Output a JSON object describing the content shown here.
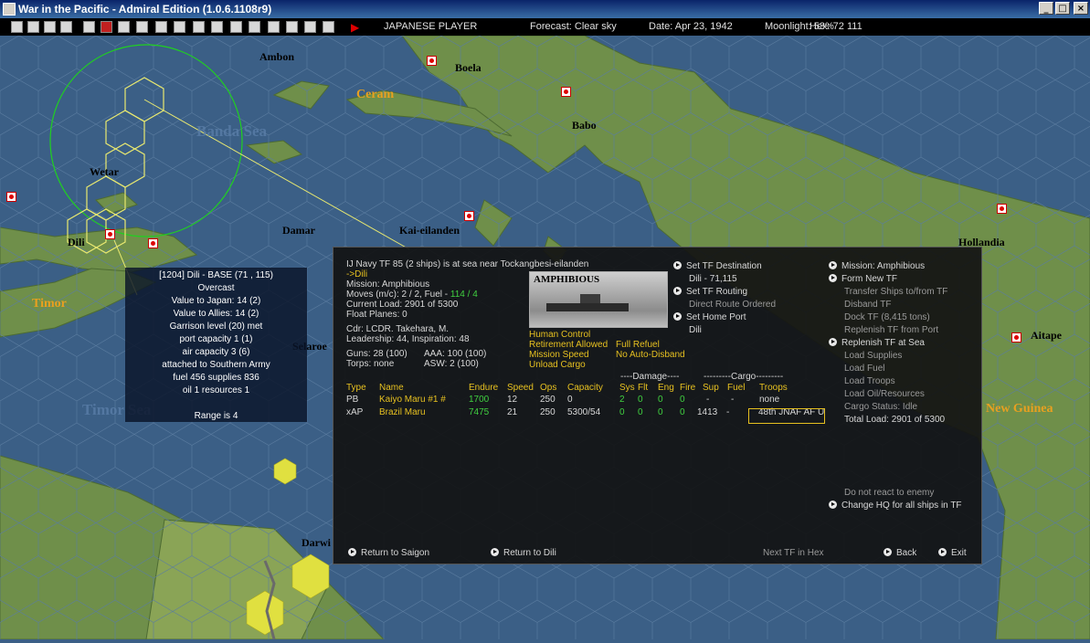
{
  "window": {
    "title": "War in the Pacific - Admiral Edition (1.0.6.1108r9)"
  },
  "status": {
    "player": "JAPANESE PLAYER",
    "forecast": "Forecast: Clear sky",
    "date": "Date: Apr 23, 1942",
    "moonlight": "Moonlight: 53%",
    "hex": "Hex: 72  111"
  },
  "toolbar": {
    "icons": [
      "save-icon",
      "document-icon",
      "report-icon",
      "info-icon",
      "japan-flag-icon",
      "ship-icon",
      "flag-icon",
      "aircraft-icon",
      "land-icon",
      "base-icon",
      "rail-icon",
      "hq-icon",
      "unit-icon",
      "settings-icon",
      "window-icon",
      "end-turn-icon"
    ]
  },
  "map": {
    "places": {
      "ambon": "Ambon",
      "boela": "Boela",
      "ceram": "Ceram",
      "banda_sea": "Banda Sea",
      "babo": "Babo",
      "wetar": "Wetar",
      "damar": "Damar",
      "kai": "Kai-eilanden",
      "hollandia": "Hollandia",
      "dili": "Dili",
      "timor": "Timor",
      "selaroe": "Selaroe",
      "timor_sea": "Timor Sea",
      "aitape": "Aitape",
      "new_guinea": "New Guinea",
      "darwin": "Darwi"
    },
    "colors": {
      "sea": "#3b5f86",
      "land": "#6f8f4a",
      "hex_highlight": "#e8e870",
      "range_circle": "#20d020"
    }
  },
  "hex_info": {
    "lines": [
      "[1204] Dili - BASE  (71 , 115)",
      "Overcast",
      "Value to Japan: 14 (2)",
      "Value to Allies: 14 (2)",
      "Garrison level (20) met",
      "port capacity 1 (1)",
      "air capacity 3 (6)",
      "attached to Southern Army",
      "fuel 456   supplies 836",
      "oil 1   resources 1",
      "",
      "Range is 4"
    ]
  },
  "tf_panel": {
    "header": "IJ Navy TF 85 (2 ships) is at sea near Tockangbesi-eilanden",
    "dest": "->Dili",
    "mission": "Mission: Amphibious",
    "moves": "Moves (m/c): 2 / 2, Fuel - ",
    "fuel_val": "114 / 4",
    "load": "Current Load: 2901 of 5300",
    "float": "Float Planes: 0",
    "cdr": "Cdr: LCDR. Takehara, M.",
    "leadership": "Leadership: 44, Inspiration: 48",
    "guns": "Guns: 28 (100)",
    "aaa": "AAA: 100 (100)",
    "torps": "Torps: none",
    "asw": "ASW: 2 (100)",
    "image_label": "AMPHIBIOUS",
    "opt_human": "Human Control",
    "opt_retire": "Retirement Allowed",
    "opt_refuel": "Full Refuel",
    "opt_speed": "Mission Speed",
    "opt_disband": "No Auto-Disband",
    "opt_unload": "Unload Cargo",
    "mid": {
      "set_dest": "Set TF Destination",
      "dest_val": "Dili - 71,115",
      "routing": "Set TF Routing",
      "route_val": "Direct Route Ordered",
      "home": "Set Home Port",
      "home_val": "Dili"
    },
    "right": {
      "mission": "Mission: Amphibious",
      "form": "Form New TF",
      "transfer": "Transfer Ships to/from TF",
      "disband": "Disband TF",
      "dock": "Dock TF (8,415 tons)",
      "replenish_port": "Replenish TF from Port",
      "replenish_sea": "Replenish TF at Sea",
      "load_supplies": "Load Supplies",
      "load_fuel": "Load Fuel",
      "load_troops": "Load Troops",
      "load_oil": "Load Oil/Resources",
      "cargo_status": "Cargo Status: Idle",
      "total_load": "Total Load: 2901 of 5300",
      "no_react": "Do not react to enemy",
      "change_hq": "Change HQ for all ships in TF"
    },
    "table": {
      "damage_header": "----Damage----",
      "cargo_header": "---------Cargo---------",
      "headers": [
        "Type",
        "Name",
        "Endure",
        "Speed",
        "Ops",
        "Capacity",
        "Sys",
        "Flt",
        "Eng",
        "Fire",
        "Sup",
        "Fuel",
        "Troops"
      ],
      "rows": [
        [
          "PB",
          "Kaiyo Maru #1 #",
          "1700",
          "12",
          "250",
          "0",
          "2",
          "0",
          "0",
          "0",
          "-",
          "-",
          "none"
        ],
        [
          "xAP",
          "Brazil Maru",
          "7475",
          "21",
          "250",
          "5300/54",
          "0",
          "0",
          "0",
          "0",
          "1413",
          "-",
          "48th JNAF AF U"
        ]
      ]
    },
    "bottom": {
      "return_saigon": "Return to Saigon",
      "return_dili": "Return to Dili",
      "next_tf": "Next TF in Hex",
      "back": "Back",
      "exit": "Exit"
    }
  }
}
